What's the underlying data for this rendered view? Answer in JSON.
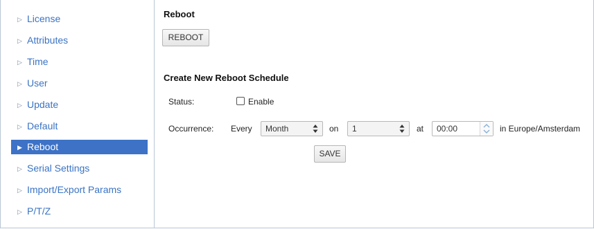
{
  "sidebar": {
    "items": [
      {
        "label": "License"
      },
      {
        "label": "Attributes"
      },
      {
        "label": "Time"
      },
      {
        "label": "User"
      },
      {
        "label": "Update"
      },
      {
        "label": "Default"
      },
      {
        "label": "Reboot"
      },
      {
        "label": "Serial Settings"
      },
      {
        "label": "Import/Export Params"
      },
      {
        "label": "P/T/Z"
      }
    ],
    "active_item": "Reboot",
    "arrow_icon": "triangle-right-icon"
  },
  "reboot": {
    "heading": "Reboot",
    "button_label": "REBOOT"
  },
  "schedule": {
    "heading": "Create New Reboot Schedule",
    "status_label": "Status:",
    "enable_label": "Enable",
    "enable_checked": false,
    "occurrence_label": "Occurrence:",
    "every_label": "Every",
    "frequency_value": "Month",
    "on_label": "on",
    "day_value": "1",
    "at_label": "at",
    "time_value": "00:00",
    "timezone_text": "in Europe/Amsterdam",
    "save_label": "SAVE"
  },
  "colors": {
    "accent": "#3d72c6",
    "link": "#3a73c4",
    "border": "#b8c6d6"
  }
}
